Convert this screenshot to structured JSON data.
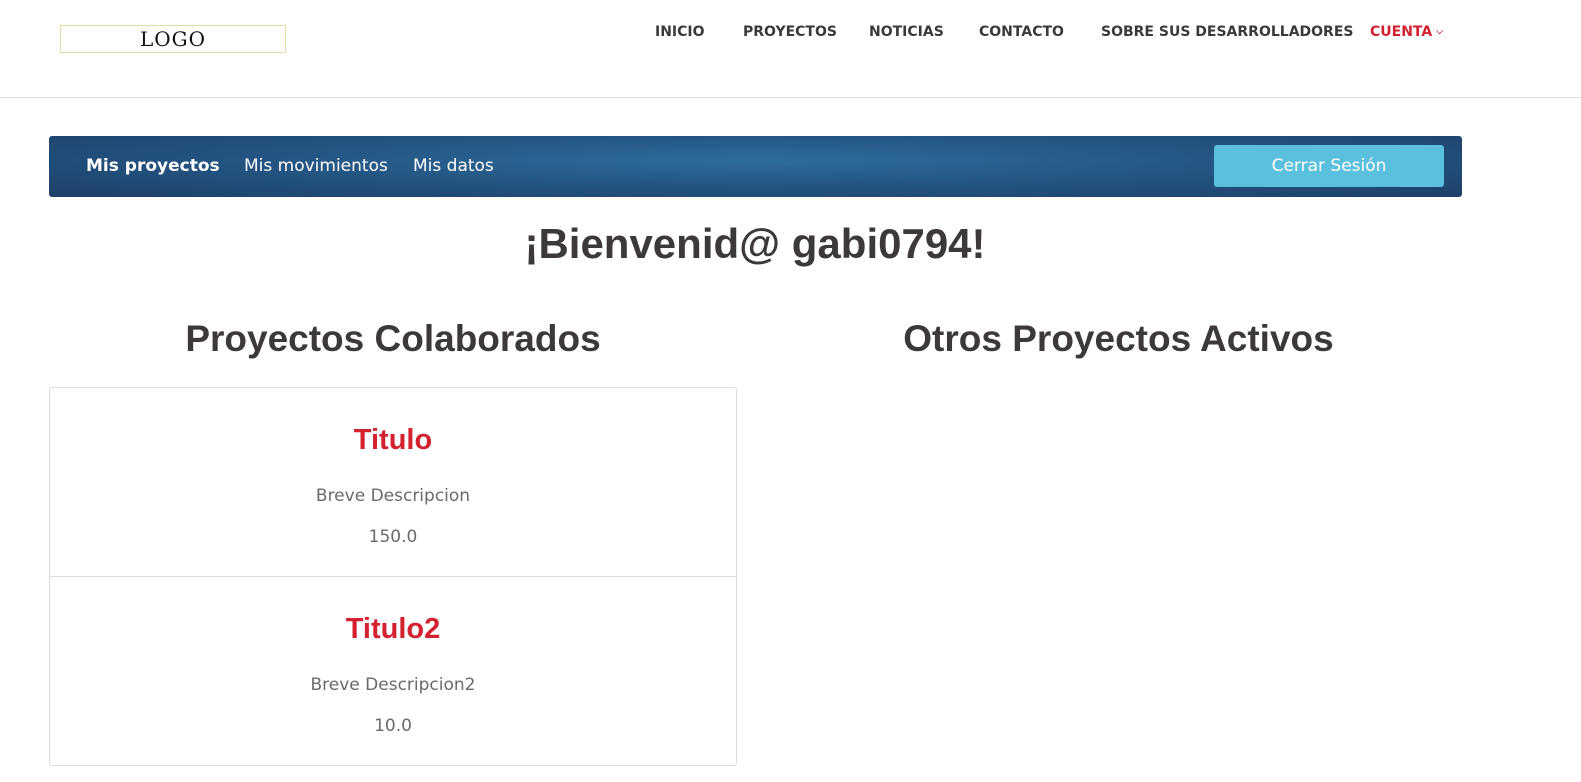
{
  "header": {
    "logo_text": "LOGO",
    "nav": [
      {
        "label": "INICIO"
      },
      {
        "label": "PROYECTOS"
      },
      {
        "label": "NOTICIAS"
      },
      {
        "label": "CONTACTO"
      },
      {
        "label": "SOBRE SUS DESARROLLADORES"
      },
      {
        "label": "CUENTA",
        "icon": "chevron-down-icon",
        "active": true
      }
    ],
    "active_color": "#d3212f"
  },
  "account_bar": {
    "tabs": [
      {
        "label": "Mis proyectos",
        "active": true
      },
      {
        "label": "Mis movimientos"
      },
      {
        "label": "Mis datos"
      }
    ],
    "logout_label": "Cerrar Sesión",
    "logout_color": "#5bc0de"
  },
  "welcome": "¡Bienvenid@ gabi0794!",
  "sections": {
    "collaborated_title": "Proyectos Colaborados",
    "others_title": "Otros Proyectos Activos"
  },
  "projects": [
    {
      "title": "Titulo",
      "description": "Breve Descripcion",
      "value": "150.0"
    },
    {
      "title": "Titulo2",
      "description": "Breve Descripcion2",
      "value": "10.0"
    }
  ]
}
